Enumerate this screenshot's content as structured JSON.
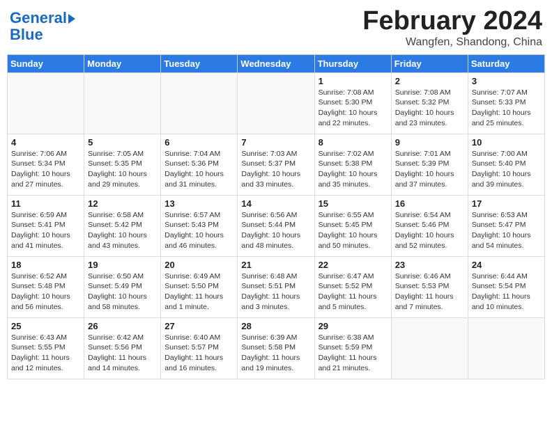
{
  "header": {
    "logo_line1": "General",
    "logo_line2": "Blue",
    "month": "February 2024",
    "location": "Wangfen, Shandong, China"
  },
  "weekdays": [
    "Sunday",
    "Monday",
    "Tuesday",
    "Wednesday",
    "Thursday",
    "Friday",
    "Saturday"
  ],
  "weeks": [
    [
      {
        "day": "",
        "info": ""
      },
      {
        "day": "",
        "info": ""
      },
      {
        "day": "",
        "info": ""
      },
      {
        "day": "",
        "info": ""
      },
      {
        "day": "1",
        "info": "Sunrise: 7:08 AM\nSunset: 5:30 PM\nDaylight: 10 hours\nand 22 minutes."
      },
      {
        "day": "2",
        "info": "Sunrise: 7:08 AM\nSunset: 5:32 PM\nDaylight: 10 hours\nand 23 minutes."
      },
      {
        "day": "3",
        "info": "Sunrise: 7:07 AM\nSunset: 5:33 PM\nDaylight: 10 hours\nand 25 minutes."
      }
    ],
    [
      {
        "day": "4",
        "info": "Sunrise: 7:06 AM\nSunset: 5:34 PM\nDaylight: 10 hours\nand 27 minutes."
      },
      {
        "day": "5",
        "info": "Sunrise: 7:05 AM\nSunset: 5:35 PM\nDaylight: 10 hours\nand 29 minutes."
      },
      {
        "day": "6",
        "info": "Sunrise: 7:04 AM\nSunset: 5:36 PM\nDaylight: 10 hours\nand 31 minutes."
      },
      {
        "day": "7",
        "info": "Sunrise: 7:03 AM\nSunset: 5:37 PM\nDaylight: 10 hours\nand 33 minutes."
      },
      {
        "day": "8",
        "info": "Sunrise: 7:02 AM\nSunset: 5:38 PM\nDaylight: 10 hours\nand 35 minutes."
      },
      {
        "day": "9",
        "info": "Sunrise: 7:01 AM\nSunset: 5:39 PM\nDaylight: 10 hours\nand 37 minutes."
      },
      {
        "day": "10",
        "info": "Sunrise: 7:00 AM\nSunset: 5:40 PM\nDaylight: 10 hours\nand 39 minutes."
      }
    ],
    [
      {
        "day": "11",
        "info": "Sunrise: 6:59 AM\nSunset: 5:41 PM\nDaylight: 10 hours\nand 41 minutes."
      },
      {
        "day": "12",
        "info": "Sunrise: 6:58 AM\nSunset: 5:42 PM\nDaylight: 10 hours\nand 43 minutes."
      },
      {
        "day": "13",
        "info": "Sunrise: 6:57 AM\nSunset: 5:43 PM\nDaylight: 10 hours\nand 46 minutes."
      },
      {
        "day": "14",
        "info": "Sunrise: 6:56 AM\nSunset: 5:44 PM\nDaylight: 10 hours\nand 48 minutes."
      },
      {
        "day": "15",
        "info": "Sunrise: 6:55 AM\nSunset: 5:45 PM\nDaylight: 10 hours\nand 50 minutes."
      },
      {
        "day": "16",
        "info": "Sunrise: 6:54 AM\nSunset: 5:46 PM\nDaylight: 10 hours\nand 52 minutes."
      },
      {
        "day": "17",
        "info": "Sunrise: 6:53 AM\nSunset: 5:47 PM\nDaylight: 10 hours\nand 54 minutes."
      }
    ],
    [
      {
        "day": "18",
        "info": "Sunrise: 6:52 AM\nSunset: 5:48 PM\nDaylight: 10 hours\nand 56 minutes."
      },
      {
        "day": "19",
        "info": "Sunrise: 6:50 AM\nSunset: 5:49 PM\nDaylight: 10 hours\nand 58 minutes."
      },
      {
        "day": "20",
        "info": "Sunrise: 6:49 AM\nSunset: 5:50 PM\nDaylight: 11 hours\nand 1 minute."
      },
      {
        "day": "21",
        "info": "Sunrise: 6:48 AM\nSunset: 5:51 PM\nDaylight: 11 hours\nand 3 minutes."
      },
      {
        "day": "22",
        "info": "Sunrise: 6:47 AM\nSunset: 5:52 PM\nDaylight: 11 hours\nand 5 minutes."
      },
      {
        "day": "23",
        "info": "Sunrise: 6:46 AM\nSunset: 5:53 PM\nDaylight: 11 hours\nand 7 minutes."
      },
      {
        "day": "24",
        "info": "Sunrise: 6:44 AM\nSunset: 5:54 PM\nDaylight: 11 hours\nand 10 minutes."
      }
    ],
    [
      {
        "day": "25",
        "info": "Sunrise: 6:43 AM\nSunset: 5:55 PM\nDaylight: 11 hours\nand 12 minutes."
      },
      {
        "day": "26",
        "info": "Sunrise: 6:42 AM\nSunset: 5:56 PM\nDaylight: 11 hours\nand 14 minutes."
      },
      {
        "day": "27",
        "info": "Sunrise: 6:40 AM\nSunset: 5:57 PM\nDaylight: 11 hours\nand 16 minutes."
      },
      {
        "day": "28",
        "info": "Sunrise: 6:39 AM\nSunset: 5:58 PM\nDaylight: 11 hours\nand 19 minutes."
      },
      {
        "day": "29",
        "info": "Sunrise: 6:38 AM\nSunset: 5:59 PM\nDaylight: 11 hours\nand 21 minutes."
      },
      {
        "day": "",
        "info": ""
      },
      {
        "day": "",
        "info": ""
      }
    ]
  ]
}
